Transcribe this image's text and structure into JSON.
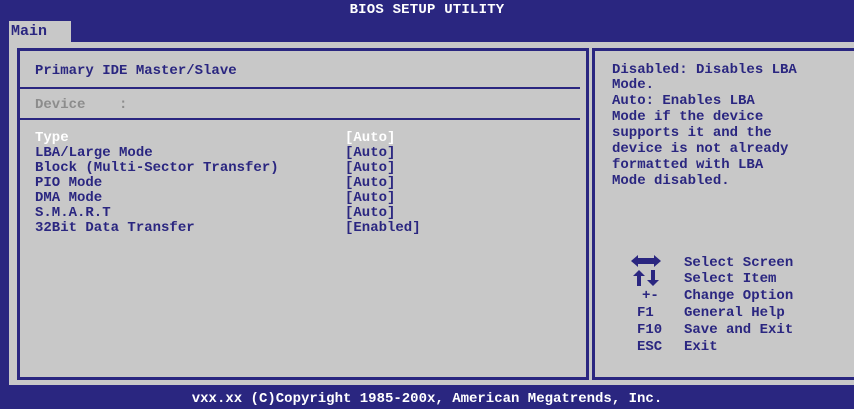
{
  "window": {
    "title": "BIOS SETUP UTILITY",
    "active_tab": "Main",
    "footer": "vxx.xx (C)Copyright 1985-200x, American Megatrends, Inc."
  },
  "left": {
    "heading": "Primary IDE Master/Slave",
    "device_label": "Device    :",
    "items": [
      {
        "label": "Type",
        "value": "[Auto]"
      },
      {
        "label": "LBA/Large Mode",
        "value": "[Auto]"
      },
      {
        "label": "Block (Multi-Sector Transfer)",
        "value": "[Auto]"
      },
      {
        "label": "PIO Mode",
        "value": "[Auto]"
      },
      {
        "label": "DMA Mode",
        "value": "[Auto]"
      },
      {
        "label": "S.M.A.R.T",
        "value": "[Auto]"
      },
      {
        "label": "32Bit Data Transfer",
        "value": "[Enabled]"
      }
    ]
  },
  "help": {
    "lines": [
      "Disabled: Disables LBA",
      "Mode.",
      "Auto: Enables LBA",
      "Mode if the device",
      "supports it and the",
      "device is not already",
      "formatted with LBA",
      "Mode disabled."
    ]
  },
  "keys": [
    {
      "key": "",
      "icon": "left-right-arrow-icon",
      "desc": "Select Screen"
    },
    {
      "key": "",
      "icon": "up-down-arrow-icon",
      "desc": "Select Item"
    },
    {
      "key": "+-",
      "desc": "Change Option"
    },
    {
      "key": "F1",
      "desc": "General Help"
    },
    {
      "key": "F10",
      "desc": "Save and Exit"
    },
    {
      "key": "ESC",
      "desc": "Exit"
    }
  ],
  "colors": {
    "background": "#2a2680",
    "panel": "#c8c8c8",
    "highlight_text": "#ffffff",
    "disabled_text": "#8c8c8c"
  }
}
